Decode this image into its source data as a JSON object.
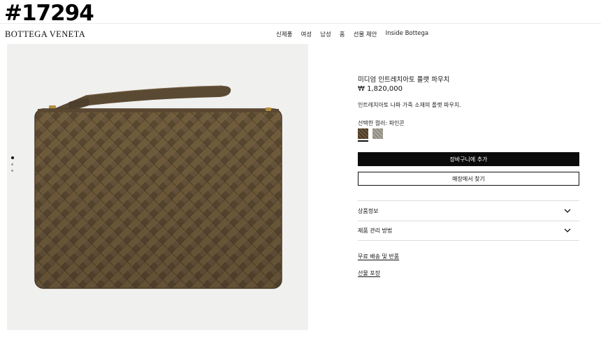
{
  "overlay": {
    "id_tag": "#17294"
  },
  "header": {
    "brand": "BOTTEGA VENETA",
    "nav": [
      "신제품",
      "여성",
      "남성",
      "홈",
      "선물 제안",
      "Inside Bottega"
    ]
  },
  "gallery": {
    "image_subject": "woven leather pouch",
    "slide_count": 3,
    "active_slide": 1
  },
  "product": {
    "title": "미디엄 인트레치아토 플랫 파우치",
    "price": "₩ 1,820,000",
    "description": "인트레치아토 나파 가죽 소재의 플랫 파우치.",
    "color_label": "선택한 컬러: 파인콘",
    "swatch_colors": [
      "#5e4b34",
      "#9d9b90"
    ],
    "add_to_cart": "장바구니에 추가",
    "find_in_store": "매장에서 찾기"
  },
  "accordion": [
    {
      "label": "상품정보"
    },
    {
      "label": "제품 관리 방법"
    }
  ],
  "links": {
    "shipping": "무료 배송 및 반품",
    "gift": "선물 포장"
  }
}
